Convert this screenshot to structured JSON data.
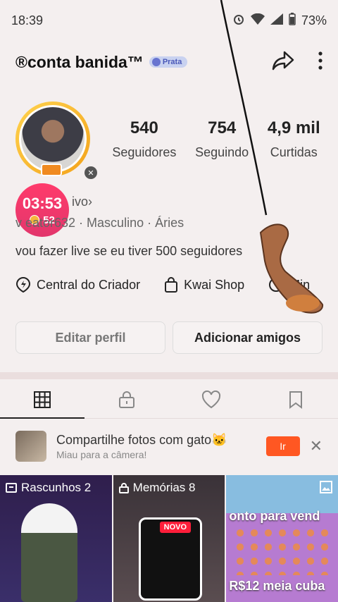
{
  "status_bar": {
    "time": "18:39",
    "battery": "73%"
  },
  "header": {
    "name": "®conta banida™",
    "rank": "Prata"
  },
  "stats": [
    {
      "value": "540",
      "label": "Seguidores"
    },
    {
      "value": "754",
      "label": "Seguindo"
    },
    {
      "value": "4,9 mil",
      "label": "Curtidas"
    }
  ],
  "timer": {
    "time": "03:53",
    "coins": "52"
  },
  "status_text": "ivo›",
  "meta": "v    eator632 · Masculino · Áries",
  "bio": "vou fazer live se eu tiver 500 seguidores",
  "creator_links": [
    {
      "label": "Central do Criador",
      "icon": "creator-icon"
    },
    {
      "label": "Kwai Shop",
      "icon": "shop-bag-icon"
    },
    {
      "label": "Min",
      "icon": "mini-icon"
    }
  ],
  "buttons": {
    "edit": "Editar perfil",
    "add": "Adicionar amigos"
  },
  "promo": {
    "title": "Compartilhe fotos com gato🐱",
    "subtitle": "Miau para a câmera!",
    "go": "Ir"
  },
  "grid": {
    "drafts": "Rascunhos 2",
    "memories": "Memórias 8",
    "new_badge": "NOVO",
    "post_text": "onto para vend",
    "post_price": "R$12 meia cuba"
  },
  "colors": {
    "accent": "#ff5722",
    "timer": "#e2366c",
    "rank_badge": "#c9d2f0"
  }
}
